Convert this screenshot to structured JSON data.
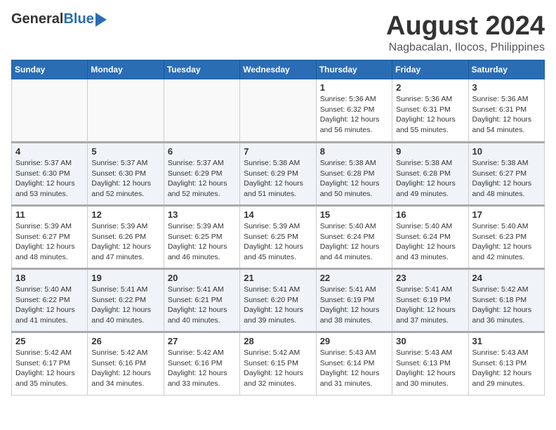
{
  "logo": {
    "general": "General",
    "blue": "Blue"
  },
  "header": {
    "title": "August 2024",
    "subtitle": "Nagbacalan, Ilocos, Philippines"
  },
  "days_of_week": [
    "Sunday",
    "Monday",
    "Tuesday",
    "Wednesday",
    "Thursday",
    "Friday",
    "Saturday"
  ],
  "weeks": [
    [
      {
        "day": "",
        "content": ""
      },
      {
        "day": "",
        "content": ""
      },
      {
        "day": "",
        "content": ""
      },
      {
        "day": "",
        "content": ""
      },
      {
        "day": "1",
        "content": "Sunrise: 5:36 AM\nSunset: 6:32 PM\nDaylight: 12 hours\nand 56 minutes."
      },
      {
        "day": "2",
        "content": "Sunrise: 5:36 AM\nSunset: 6:31 PM\nDaylight: 12 hours\nand 55 minutes."
      },
      {
        "day": "3",
        "content": "Sunrise: 5:36 AM\nSunset: 6:31 PM\nDaylight: 12 hours\nand 54 minutes."
      }
    ],
    [
      {
        "day": "4",
        "content": "Sunrise: 5:37 AM\nSunset: 6:30 PM\nDaylight: 12 hours\nand 53 minutes."
      },
      {
        "day": "5",
        "content": "Sunrise: 5:37 AM\nSunset: 6:30 PM\nDaylight: 12 hours\nand 52 minutes."
      },
      {
        "day": "6",
        "content": "Sunrise: 5:37 AM\nSunset: 6:29 PM\nDaylight: 12 hours\nand 52 minutes."
      },
      {
        "day": "7",
        "content": "Sunrise: 5:38 AM\nSunset: 6:29 PM\nDaylight: 12 hours\nand 51 minutes."
      },
      {
        "day": "8",
        "content": "Sunrise: 5:38 AM\nSunset: 6:28 PM\nDaylight: 12 hours\nand 50 minutes."
      },
      {
        "day": "9",
        "content": "Sunrise: 5:38 AM\nSunset: 6:28 PM\nDaylight: 12 hours\nand 49 minutes."
      },
      {
        "day": "10",
        "content": "Sunrise: 5:38 AM\nSunset: 6:27 PM\nDaylight: 12 hours\nand 48 minutes."
      }
    ],
    [
      {
        "day": "11",
        "content": "Sunrise: 5:39 AM\nSunset: 6:27 PM\nDaylight: 12 hours\nand 48 minutes."
      },
      {
        "day": "12",
        "content": "Sunrise: 5:39 AM\nSunset: 6:26 PM\nDaylight: 12 hours\nand 47 minutes."
      },
      {
        "day": "13",
        "content": "Sunrise: 5:39 AM\nSunset: 6:25 PM\nDaylight: 12 hours\nand 46 minutes."
      },
      {
        "day": "14",
        "content": "Sunrise: 5:39 AM\nSunset: 6:25 PM\nDaylight: 12 hours\nand 45 minutes."
      },
      {
        "day": "15",
        "content": "Sunrise: 5:40 AM\nSunset: 6:24 PM\nDaylight: 12 hours\nand 44 minutes."
      },
      {
        "day": "16",
        "content": "Sunrise: 5:40 AM\nSunset: 6:24 PM\nDaylight: 12 hours\nand 43 minutes."
      },
      {
        "day": "17",
        "content": "Sunrise: 5:40 AM\nSunset: 6:23 PM\nDaylight: 12 hours\nand 42 minutes."
      }
    ],
    [
      {
        "day": "18",
        "content": "Sunrise: 5:40 AM\nSunset: 6:22 PM\nDaylight: 12 hours\nand 41 minutes."
      },
      {
        "day": "19",
        "content": "Sunrise: 5:41 AM\nSunset: 6:22 PM\nDaylight: 12 hours\nand 40 minutes."
      },
      {
        "day": "20",
        "content": "Sunrise: 5:41 AM\nSunset: 6:21 PM\nDaylight: 12 hours\nand 40 minutes."
      },
      {
        "day": "21",
        "content": "Sunrise: 5:41 AM\nSunset: 6:20 PM\nDaylight: 12 hours\nand 39 minutes."
      },
      {
        "day": "22",
        "content": "Sunrise: 5:41 AM\nSunset: 6:19 PM\nDaylight: 12 hours\nand 38 minutes."
      },
      {
        "day": "23",
        "content": "Sunrise: 5:41 AM\nSunset: 6:19 PM\nDaylight: 12 hours\nand 37 minutes."
      },
      {
        "day": "24",
        "content": "Sunrise: 5:42 AM\nSunset: 6:18 PM\nDaylight: 12 hours\nand 36 minutes."
      }
    ],
    [
      {
        "day": "25",
        "content": "Sunrise: 5:42 AM\nSunset: 6:17 PM\nDaylight: 12 hours\nand 35 minutes."
      },
      {
        "day": "26",
        "content": "Sunrise: 5:42 AM\nSunset: 6:16 PM\nDaylight: 12 hours\nand 34 minutes."
      },
      {
        "day": "27",
        "content": "Sunrise: 5:42 AM\nSunset: 6:16 PM\nDaylight: 12 hours\nand 33 minutes."
      },
      {
        "day": "28",
        "content": "Sunrise: 5:42 AM\nSunset: 6:15 PM\nDaylight: 12 hours\nand 32 minutes."
      },
      {
        "day": "29",
        "content": "Sunrise: 5:43 AM\nSunset: 6:14 PM\nDaylight: 12 hours\nand 31 minutes."
      },
      {
        "day": "30",
        "content": "Sunrise: 5:43 AM\nSunset: 6:13 PM\nDaylight: 12 hours\nand 30 minutes."
      },
      {
        "day": "31",
        "content": "Sunrise: 5:43 AM\nSunset: 6:13 PM\nDaylight: 12 hours\nand 29 minutes."
      }
    ]
  ]
}
